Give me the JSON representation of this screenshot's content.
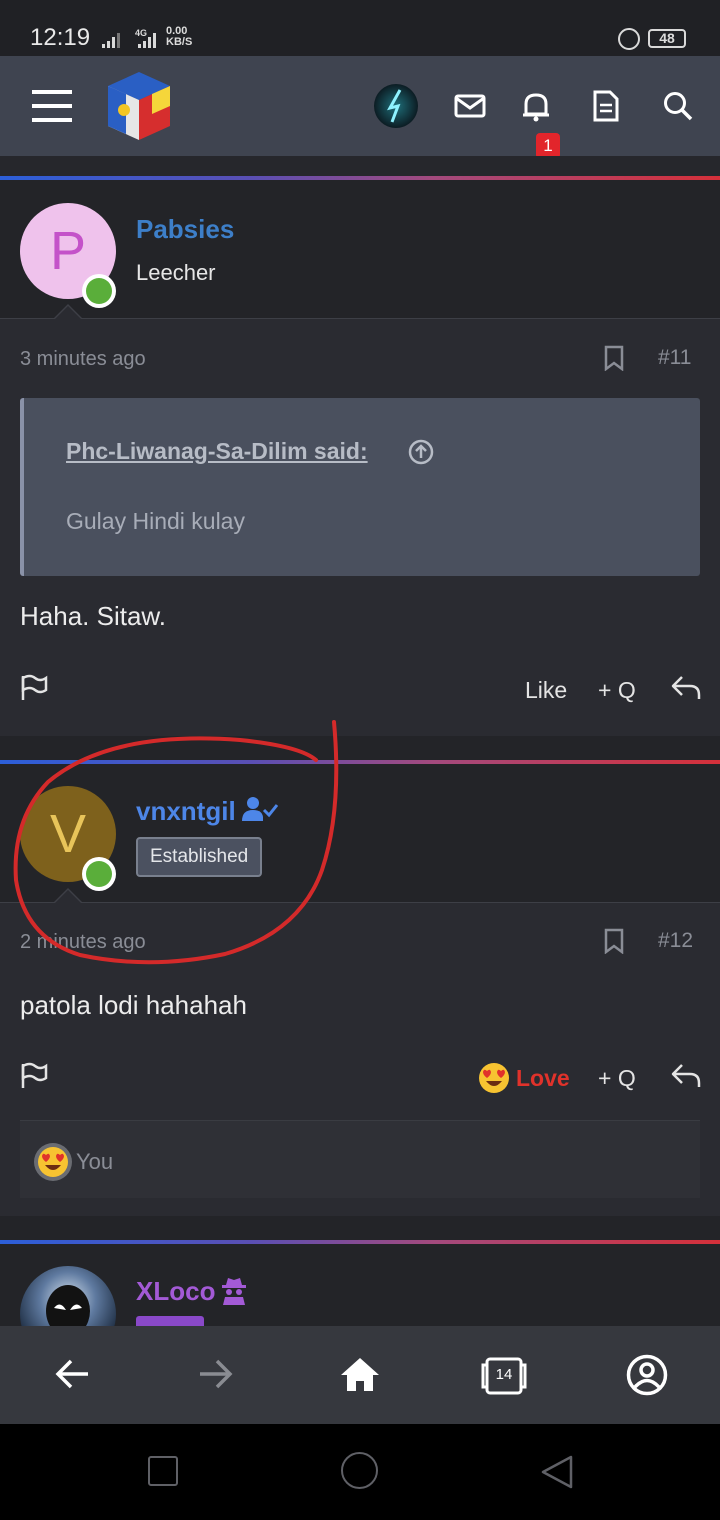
{
  "status_bar": {
    "time": "12:19",
    "network_type": "4G",
    "speed_value": "0.00",
    "speed_unit": "KB/S",
    "battery": "48"
  },
  "header": {
    "notification_count": "1",
    "icons": [
      "menu-icon",
      "site-logo",
      "user-avatar",
      "mail-icon",
      "bell-icon",
      "document-icon",
      "search-icon"
    ]
  },
  "posts": [
    {
      "avatar_letter": "P",
      "username": "Pabsies",
      "user_title": "Leecher",
      "time": "3 minutes ago",
      "number": "#11",
      "quote": {
        "author": "Phc-Liwanag-Sa-Dilim said:",
        "text": "Gulay Hindi kulay"
      },
      "text": "Haha. Sitaw.",
      "reaction_label": "Like",
      "quote_label": "+ Q"
    },
    {
      "avatar_letter": "V",
      "username": "vnxntgil",
      "user_badge": "Established",
      "time": "2 minutes ago",
      "number": "#12",
      "text": "patola lodi hahahah",
      "reaction_label": "Love",
      "quote_label": "+ Q",
      "reactions_by": "You"
    },
    {
      "username": "XLoco"
    }
  ],
  "bottom_nav": {
    "tab_count": "14"
  },
  "colors": {
    "accent_blue": "#3d7fc9",
    "username_blue": "#4d86e8",
    "username_purple": "#a35ad6",
    "love_red": "#e0322b",
    "online_green": "#5aae3a",
    "annotation_red": "#d42a2a"
  }
}
